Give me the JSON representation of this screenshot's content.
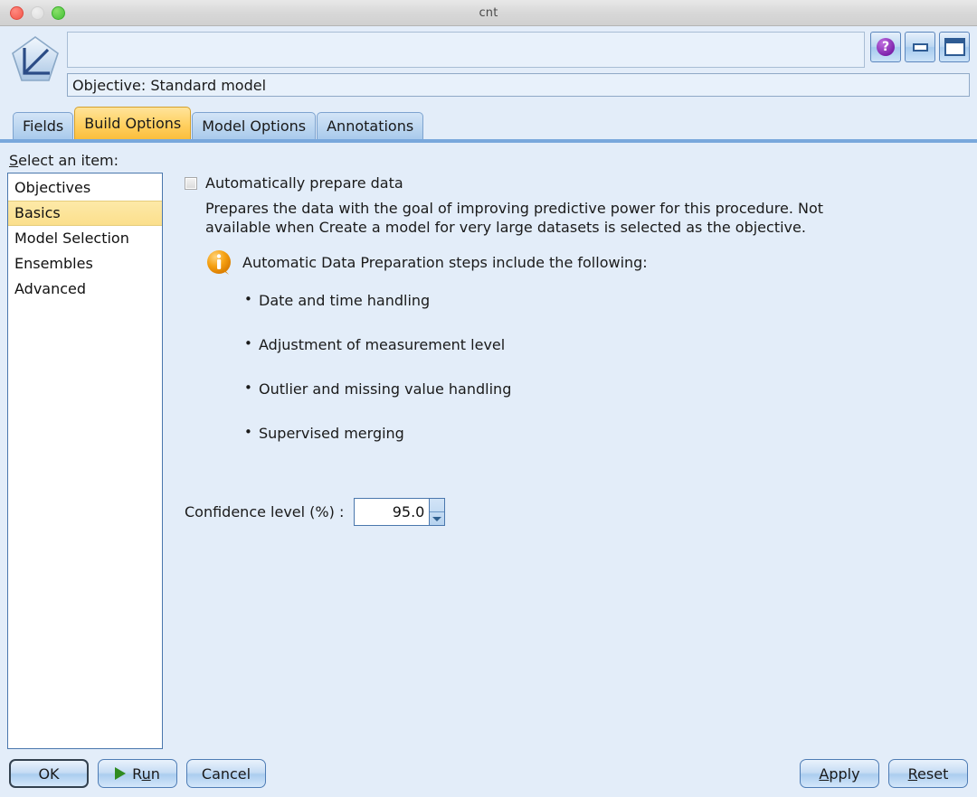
{
  "window": {
    "title": "cnt",
    "traffic_lights": [
      "close",
      "minimize",
      "zoom"
    ]
  },
  "header": {
    "name_field_value": "",
    "objective_field_value": "Objective: Standard model",
    "buttons": [
      {
        "name": "help-button",
        "icon": "question-mark-icon",
        "glyph": "?"
      },
      {
        "name": "minimize-button",
        "icon": "minimize-icon"
      },
      {
        "name": "maximize-button",
        "icon": "maximize-icon"
      }
    ],
    "app_icon": "spss-modeler-pentagon-icon"
  },
  "tabs": [
    {
      "label": "Fields",
      "active": false
    },
    {
      "label": "Build Options",
      "active": true
    },
    {
      "label": "Model Options",
      "active": false
    },
    {
      "label": "Annotations",
      "active": false
    }
  ],
  "content": {
    "select_label_mnemonic": "S",
    "select_label_rest": "elect an item:",
    "list_items": [
      {
        "label": "Objectives",
        "selected": false
      },
      {
        "label": "Basics",
        "selected": true
      },
      {
        "label": "Model Selection",
        "selected": false
      },
      {
        "label": "Ensembles",
        "selected": false
      },
      {
        "label": "Advanced",
        "selected": false
      }
    ],
    "checkbox": {
      "label": "Automatically prepare data",
      "checked": false,
      "enabled": false
    },
    "description": "Prepares the data with the goal of improving predictive power for this procedure.  Not available when Create a model for very large datasets is selected as the objective.",
    "info": {
      "icon": "info-icon",
      "text": "Automatic Data Preparation steps include the following:"
    },
    "bullets": [
      "Date and time handling",
      "Adjustment of measurement level",
      "Outlier and missing value handling",
      "Supervised merging"
    ],
    "confidence": {
      "label": "Confidence level (%) :",
      "value": "95.0"
    }
  },
  "footer": {
    "left_buttons": [
      {
        "name": "ok-button",
        "label": "OK",
        "default": true,
        "icon": null,
        "mnemonic": null
      },
      {
        "name": "run-button",
        "label": "R",
        "mnemonic": "u",
        "label_tail": "n",
        "icon": "play-icon",
        "default": false
      },
      {
        "name": "cancel-button",
        "label": "Cancel",
        "default": false,
        "icon": null,
        "mnemonic": null
      }
    ],
    "right_buttons": [
      {
        "name": "apply-button",
        "mnemonic": "A",
        "label_tail": "pply"
      },
      {
        "name": "reset-button",
        "mnemonic": "R",
        "label_tail": "eset"
      }
    ]
  },
  "colors": {
    "dialog_bg": "#e3edf9",
    "accent_tab_active": "#ffd061",
    "list_selected": "#fbdf8c",
    "button_blue": "#abcdef",
    "info_orange": "#f29600",
    "play_green": "#2f8b20"
  }
}
